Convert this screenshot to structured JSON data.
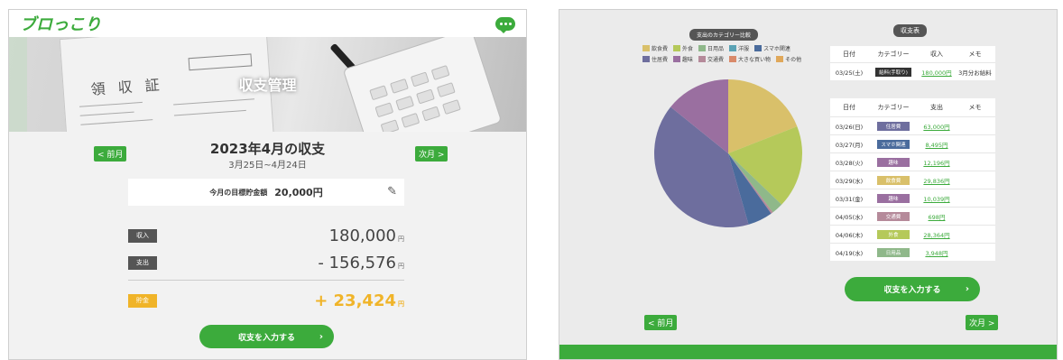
{
  "left": {
    "logo": "ブロっこり",
    "hero_title": "収支管理",
    "prev_button": "< 前月",
    "next_button": "次月 >",
    "period_title": "2023年4月の収支",
    "period_range": "3月25日~4月24日",
    "goal_label": "今月の目標貯金額",
    "goal_value": "20,000円",
    "income_label": "収入",
    "income_value": "180,000",
    "expense_label": "支出",
    "expense_value": "- 156,576",
    "savings_label": "貯金",
    "savings_value": "+ 23,424",
    "yen": "円",
    "cta": "収支を入力する",
    "cta_arrow": "›",
    "edit_icon": "pencil-icon",
    "accent": "#3cab3c",
    "gold": "#f0b429"
  },
  "right": {
    "pie_title": "支出のカテゴリー比較",
    "table_title": "収支表",
    "legend": [
      {
        "label": "飲食費",
        "color": "#d9c06a"
      },
      {
        "label": "外食",
        "color": "#b5c95a"
      },
      {
        "label": "日用品",
        "color": "#8fb88a"
      },
      {
        "label": "洋服",
        "color": "#5ba3b5"
      },
      {
        "label": "スマホ関連",
        "color": "#4a6b9c"
      },
      {
        "label": "住居費",
        "color": "#6e6e9e"
      },
      {
        "label": "趣味",
        "color": "#9a6fa0"
      },
      {
        "label": "交通費",
        "color": "#b58a9a"
      },
      {
        "label": "大きな買い物",
        "color": "#d98a6a"
      },
      {
        "label": "その他",
        "color": "#e0a85a"
      }
    ],
    "chart_data": {
      "type": "pie",
      "slices": [
        {
          "label": "飲食費",
          "value": 29836,
          "color": "#d9c06a"
        },
        {
          "label": "外食",
          "value": 28364,
          "color": "#b5c95a"
        },
        {
          "label": "日用品",
          "value": 3948,
          "color": "#8fb88a"
        },
        {
          "label": "交通費",
          "value": 698,
          "color": "#b58a9a"
        },
        {
          "label": "スマホ関連",
          "value": 8495,
          "color": "#4a6b9c"
        },
        {
          "label": "住居費",
          "value": 63000,
          "color": "#6e6e9e"
        },
        {
          "label": "趣味",
          "value": 22235,
          "color": "#9a6fa0"
        }
      ]
    },
    "income_headers": [
      "日付",
      "カテゴリー",
      "収入",
      "メモ"
    ],
    "income_rows": [
      {
        "date": "03/25(土)",
        "category": "給料(手取り)",
        "amount": "180,000円",
        "memo": "3月分お給料",
        "color": "#333333"
      }
    ],
    "expense_headers": [
      "日付",
      "カテゴリー",
      "支出",
      "メモ"
    ],
    "expense_rows": [
      {
        "date": "03/26(日)",
        "category": "住居費",
        "amount": "63,000円",
        "color": "#6e6e9e"
      },
      {
        "date": "03/27(月)",
        "category": "スマホ関連",
        "amount": "8,495円",
        "color": "#4a6b9c"
      },
      {
        "date": "03/28(火)",
        "category": "趣味",
        "amount": "12,196円",
        "color": "#9a6fa0"
      },
      {
        "date": "03/29(水)",
        "category": "飲食費",
        "amount": "29,836円",
        "color": "#d9c06a"
      },
      {
        "date": "03/31(金)",
        "category": "趣味",
        "amount": "10,039円",
        "color": "#9a6fa0"
      },
      {
        "date": "04/05(水)",
        "category": "交通費",
        "amount": "698円",
        "color": "#b58a9a"
      },
      {
        "date": "04/06(木)",
        "category": "外食",
        "amount": "28,364円",
        "color": "#b5c95a"
      },
      {
        "date": "04/19(水)",
        "category": "日用品",
        "amount": "3,948円",
        "color": "#8fb88a"
      }
    ],
    "cta": "収支を入力する",
    "cta_arrow": "›",
    "prev_button": "< 前月",
    "next_button": "次月 >"
  }
}
